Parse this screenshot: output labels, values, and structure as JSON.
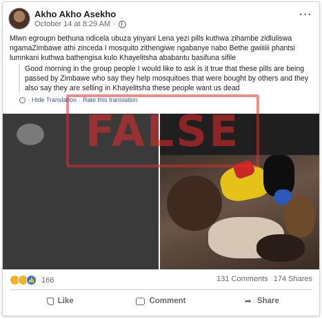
{
  "post": {
    "author": "Akho Akho Asekho",
    "date": "October 14 at 8:29 AM",
    "date_separator": "·",
    "more": "···",
    "original_text": "Mlwn egroupn bethuna ndicela ubuza yinyani Lena yezi pills kuthwa zihambe zidluliswa ngamaZimbawe athi zinceda I mosquito zithengiwe ngabanye nabo Bethe gwiiiiii phantsi lumnkani kuthwa bathengisa kulo Khayelitsha ababantu basifuna sifile",
    "translated_text": "Good morning in the group people I would like to ask is it true that these pills are being passed by Zimbawe who say they help mosquitoes that were bought by others and they also say they are selling in Khayelitsha these people want us dead",
    "hide_translation": "Hide Translation",
    "rate_translation": "Rate this translation",
    "stamp_text": "FALSE"
  },
  "stats": {
    "reaction_count": "166",
    "comments": "131 Comments",
    "shares": "174 Shares"
  },
  "actions": {
    "like": "Like",
    "comment": "Comment",
    "share": "Share"
  },
  "colors": {
    "stamp": "#e62a2a",
    "link": "#385898",
    "like_blue": "#2078f4"
  }
}
